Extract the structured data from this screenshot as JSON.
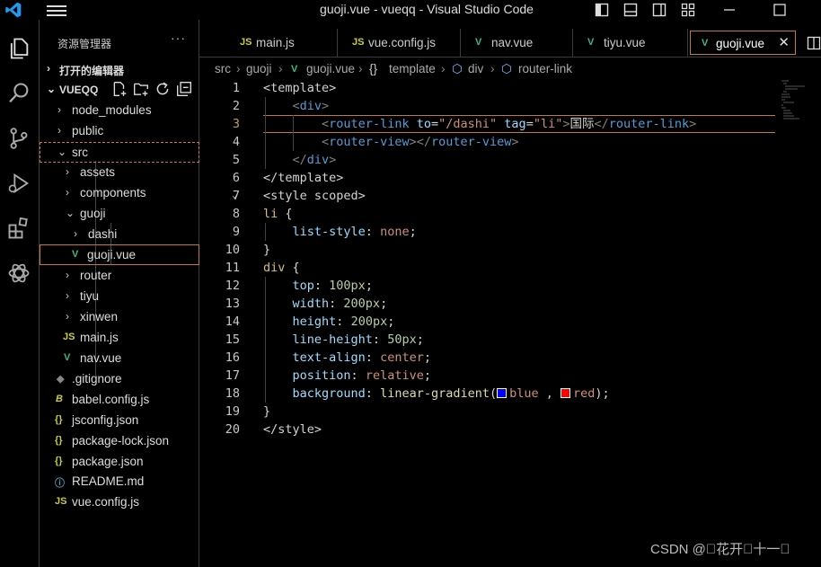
{
  "window": {
    "title": "guoji.vue - vueqq - Visual Studio Code"
  },
  "sidebar": {
    "header": "资源管理器",
    "more": "···",
    "open_editors": "打开的编辑器",
    "project": "VUEQQ",
    "tree": [
      {
        "name": "node_modules",
        "type": "folder",
        "state": "collapsed"
      },
      {
        "name": "public",
        "type": "folder",
        "state": "collapsed"
      },
      {
        "name": "src",
        "type": "folder",
        "state": "expanded"
      },
      {
        "name": "assets",
        "type": "folder",
        "state": "collapsed"
      },
      {
        "name": "components",
        "type": "folder",
        "state": "collapsed"
      },
      {
        "name": "guoji",
        "type": "folder",
        "state": "expanded"
      },
      {
        "name": "dashi",
        "type": "folder",
        "state": "collapsed"
      },
      {
        "name": "guoji.vue",
        "type": "vue"
      },
      {
        "name": "router",
        "type": "folder",
        "state": "collapsed"
      },
      {
        "name": "tiyu",
        "type": "folder",
        "state": "collapsed"
      },
      {
        "name": "xinwen",
        "type": "folder",
        "state": "collapsed"
      },
      {
        "name": "main.js",
        "type": "js"
      },
      {
        "name": "nav.vue",
        "type": "vue"
      },
      {
        "name": ".gitignore",
        "type": "git"
      },
      {
        "name": "babel.config.js",
        "type": "babel"
      },
      {
        "name": "jsconfig.json",
        "type": "json"
      },
      {
        "name": "package-lock.json",
        "type": "json"
      },
      {
        "name": "package.json",
        "type": "json"
      },
      {
        "name": "README.md",
        "type": "info"
      },
      {
        "name": "vue.config.js",
        "type": "js"
      }
    ]
  },
  "tabs": [
    {
      "label": "main.js",
      "type": "js"
    },
    {
      "label": "vue.config.js",
      "type": "js"
    },
    {
      "label": "nav.vue",
      "type": "vue"
    },
    {
      "label": "tiyu.vue",
      "type": "vue"
    },
    {
      "label": "guoji.vue",
      "type": "vue",
      "active": true
    }
  ],
  "breadcrumb": [
    "src",
    "guoji",
    "guoji.vue",
    "template",
    "div",
    "router-link"
  ],
  "editor": {
    "current_line": 3,
    "line_numbers": [
      "1",
      "2",
      "3",
      "4",
      "5",
      "6",
      "7",
      "8",
      "9",
      "10",
      "11",
      "12",
      "13",
      "14",
      "15",
      "16",
      "17",
      "18",
      "19",
      "20"
    ],
    "lines": {
      "l1": {
        "a": "<template>"
      },
      "l2": {
        "a": "<",
        "b": "div",
        "c": ">"
      },
      "l3": {
        "a": "<",
        "b": "router-link",
        "c": "to",
        "d": "=",
        "e": "\"/dashi\"",
        "f": "tag",
        "g": "=",
        "h": "\"li\"",
        "i": ">",
        "j": "国际",
        "k": "</",
        "l": "router-link",
        "m": ">"
      },
      "l4": {
        "a": "<",
        "b": "router-view",
        "c": "></",
        "d": "router-view",
        "e": ">"
      },
      "l5": {
        "a": "</",
        "b": "div",
        "c": ">"
      },
      "l6": {
        "a": "</template>"
      },
      "l7": {
        "a": "<style scoped>"
      },
      "l8": {
        "a": "li",
        "b": " {"
      },
      "l9": {
        "a": "list-style",
        "b": ": ",
        "c": "none",
        "d": ";"
      },
      "l10": {
        "a": "}"
      },
      "l11": {
        "a": "div",
        "b": " {"
      },
      "l12": {
        "a": "top",
        "b": ": ",
        "c": "100px",
        "d": ";"
      },
      "l13": {
        "a": "width",
        "b": ": ",
        "c": "200px",
        "d": ";"
      },
      "l14": {
        "a": "height",
        "b": ": ",
        "c": "200px",
        "d": ";"
      },
      "l15": {
        "a": "line-height",
        "b": ": ",
        "c": "50px",
        "d": ";"
      },
      "l16": {
        "a": "text-align",
        "b": ": ",
        "c": "center",
        "d": ";"
      },
      "l17": {
        "a": "position",
        "b": ": ",
        "c": "relative",
        "d": ";"
      },
      "l18": {
        "a": "background",
        "b": ": ",
        "c": "linear-gradient",
        "d": "(",
        "e": "blue",
        "f": " , ",
        "g": "red",
        "h": ");"
      },
      "l19": {
        "a": "}"
      },
      "l20": {
        "a": "</style>"
      }
    },
    "swatches": {
      "blue": "#0000ff",
      "red": "#ff0000"
    }
  },
  "watermark": "CSDN @\u0000花开\u0000十一\u0000",
  "colors": {
    "accent": "#c57a2e",
    "vue": "#41b883",
    "js": "#cbcb41",
    "json": "#cbcb41"
  }
}
